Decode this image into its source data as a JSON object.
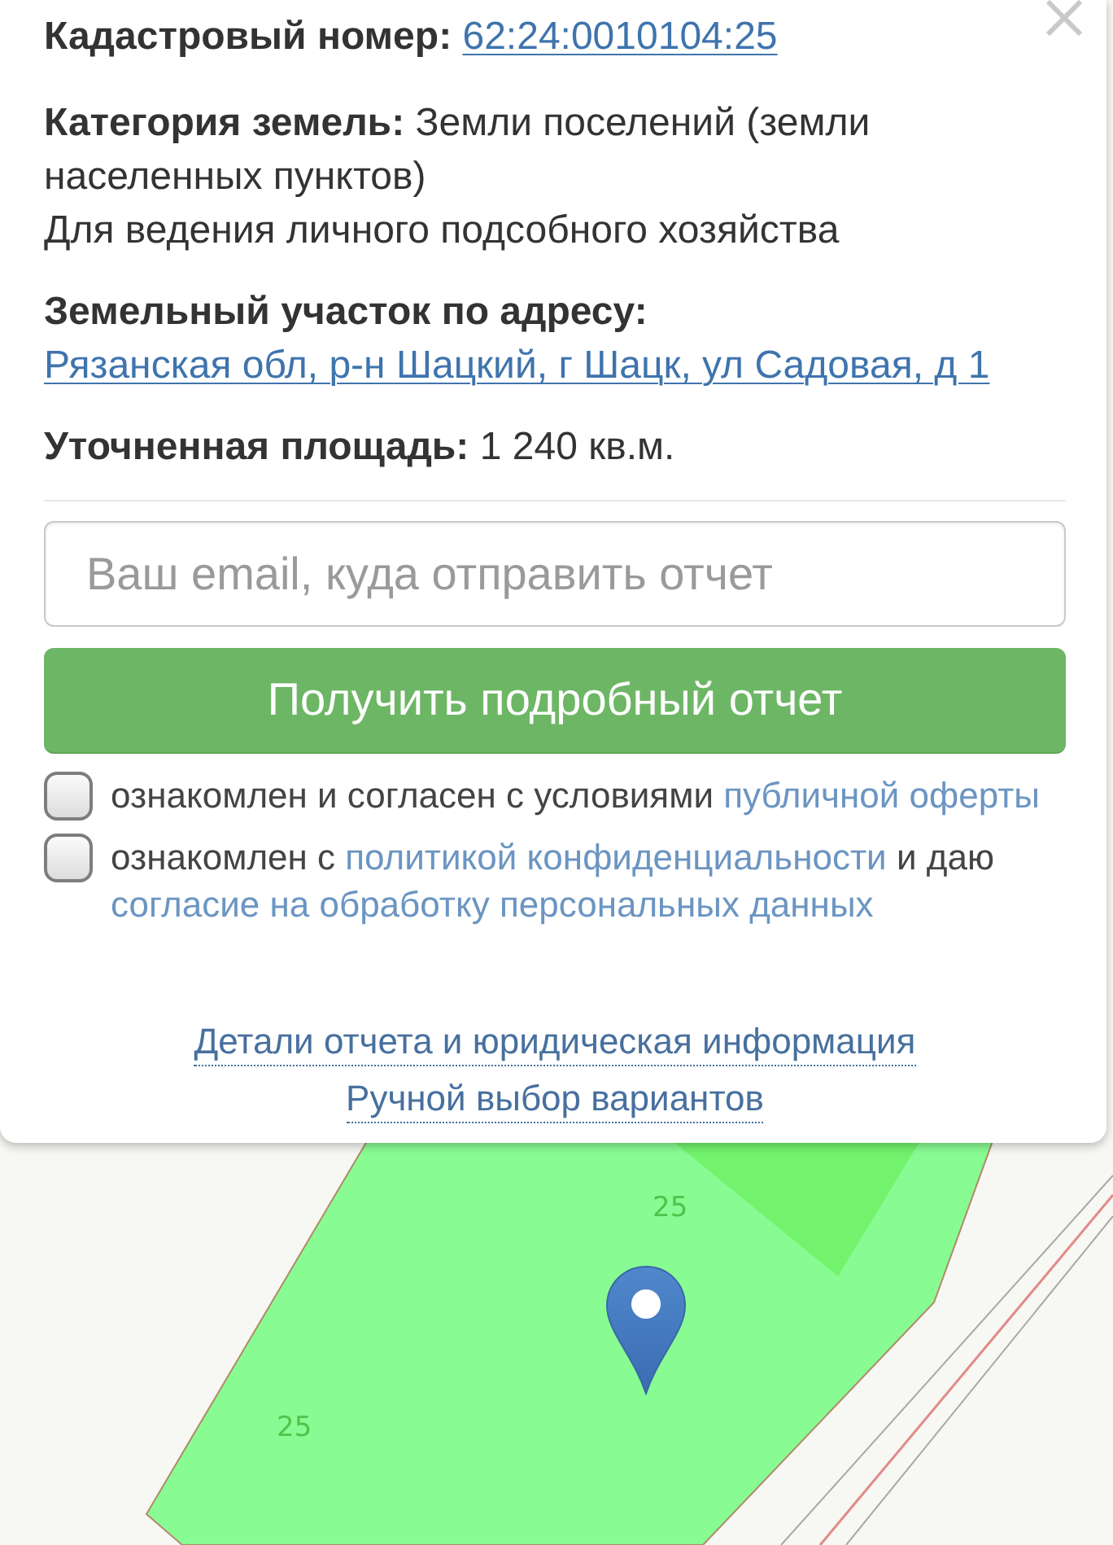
{
  "popup": {
    "fields": [
      {
        "label": "Кадастровый номер:",
        "value": "62:24:0010104:25",
        "kind": "link"
      },
      {
        "label": "Категория земель:",
        "value": "Земли поселений (земли населенных пунктов)",
        "kind": "text",
        "permitted_use": "Для ведения личного подсобного хозяйства"
      },
      {
        "label": "Земельный участок по адресу:",
        "value": "Рязанская обл, р-н Шацкий, г Шацк, ул Садовая, д 1",
        "kind": "link"
      },
      {
        "label": "Уточненная площадь:",
        "value": "1 240 кв.м.",
        "kind": "text"
      }
    ],
    "email_field": {
      "placeholder": "Ваш email, куда отправить отчет"
    },
    "submit_button": "Получить подробный отчет",
    "consents": [
      {
        "checked": false,
        "parts": [
          {
            "text": "ознакомлен и согласен с условиями ",
            "kind": "text"
          },
          {
            "text": "публичной оферты",
            "kind": "link"
          }
        ]
      },
      {
        "checked": false,
        "parts": [
          {
            "text": "ознакомлен с ",
            "kind": "text"
          },
          {
            "text": "политикой конфиденциальности",
            "kind": "link"
          },
          {
            "text": " и даю ",
            "kind": "text"
          },
          {
            "text": "согласие на обработку персональных данных",
            "kind": "link"
          }
        ]
      }
    ],
    "footer_links": [
      "Детали отчета и юридическая информация",
      "Ручной выбор вариантов"
    ]
  },
  "map": {
    "parcel_labels": [
      "25",
      "25"
    ]
  }
}
